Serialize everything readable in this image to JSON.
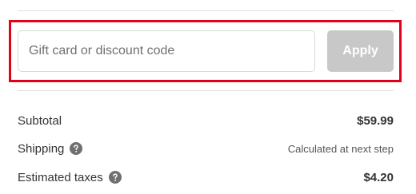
{
  "discount": {
    "placeholder": "Gift card or discount code",
    "value": "",
    "apply_label": "Apply"
  },
  "summary": {
    "subtotal": {
      "label": "Subtotal",
      "value": "$59.99"
    },
    "shipping": {
      "label": "Shipping",
      "value": "Calculated at next step",
      "icon": "question-circle-icon"
    },
    "taxes": {
      "label": "Estimated taxes",
      "value": "$4.20",
      "icon": "question-circle-icon"
    }
  },
  "colors": {
    "highlight_border": "#e2001a",
    "apply_disabled_bg": "#c8c8c8",
    "help_icon": "#707070"
  }
}
